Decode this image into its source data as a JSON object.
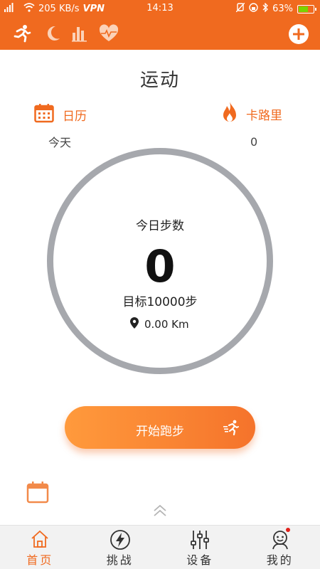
{
  "status_bar": {
    "network": "4G",
    "speed": "205 KB/s",
    "vpn": "VPN",
    "time": "14:13",
    "battery": "63%",
    "battery_level": 0.63
  },
  "toolbar": {
    "icons": [
      "running-icon",
      "moon-icon",
      "bar-chart-icon",
      "heart-rate-icon"
    ],
    "add_icon": "plus-icon"
  },
  "page": {
    "title": "运动"
  },
  "calendar": {
    "label": "日历",
    "value": "今天"
  },
  "calories": {
    "label": "卡路里",
    "value": "0"
  },
  "steps": {
    "label": "今日步数",
    "count": "0",
    "goal": "目标10000步",
    "distance": "0.00 Km"
  },
  "start_button": {
    "label": "开始跑步"
  },
  "bottom_nav": [
    {
      "label": "首页",
      "icon": "home-icon",
      "active": true
    },
    {
      "label": "挑战",
      "icon": "lightning-icon",
      "active": false
    },
    {
      "label": "设备",
      "icon": "sliders-icon",
      "active": false
    },
    {
      "label": "我的",
      "icon": "profile-icon",
      "active": false
    }
  ],
  "colors": {
    "accent": "#f06a1f",
    "ring": "#a6a8ad",
    "badge": "#e0201a"
  }
}
